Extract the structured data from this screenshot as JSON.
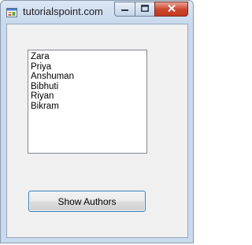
{
  "window": {
    "title": "tutorialspoint.com",
    "minimize_symbol": "—",
    "maximize_symbol": "□",
    "close_symbol": "✕"
  },
  "listbox": {
    "items": [
      "Zara",
      "Priya",
      "Anshuman",
      "Bibhuti",
      "Riyan",
      "Bikram"
    ]
  },
  "show_authors_button": {
    "label": "Show Authors"
  },
  "colors": {
    "frame": "#c9d9ee",
    "client": "#f0f0f0",
    "close_button": "#c9452c",
    "button_border": "#3c7fb1"
  },
  "icons": {
    "app": "form-app-icon",
    "minimize": "minimize-icon",
    "maximize": "maximize-icon",
    "close": "close-icon"
  }
}
